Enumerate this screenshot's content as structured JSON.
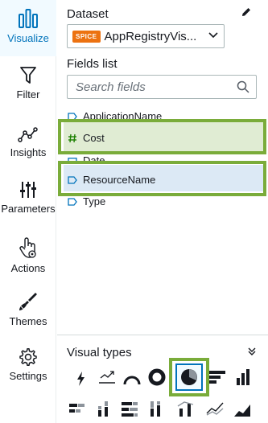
{
  "rail": {
    "items": [
      {
        "label": "Visualize",
        "icon": "visualize-icon",
        "active": true
      },
      {
        "label": "Filter",
        "icon": "filter-icon",
        "active": false
      },
      {
        "label": "Insights",
        "icon": "insights-icon",
        "active": false
      },
      {
        "label": "Parameters",
        "icon": "parameters-icon",
        "active": false
      },
      {
        "label": "Actions",
        "icon": "actions-icon",
        "active": false
      },
      {
        "label": "Themes",
        "icon": "themes-icon",
        "active": false
      },
      {
        "label": "Settings",
        "icon": "settings-icon",
        "active": false
      }
    ]
  },
  "dataset": {
    "title": "Dataset",
    "badge": "SPICE",
    "name": "AppRegistryVis...",
    "edit_icon": "pencil-icon"
  },
  "fields": {
    "title": "Fields list",
    "search_placeholder": "Search fields",
    "items": [
      {
        "label": "ApplicationName",
        "type": "dimension",
        "icon": "dimension-tag-icon"
      },
      {
        "label": "Cost",
        "type": "measure",
        "icon": "hash-icon",
        "highlighted": true
      },
      {
        "label": "Date",
        "type": "date",
        "icon": "calendar-icon"
      },
      {
        "label": "ResourceName",
        "type": "dimension",
        "icon": "dimension-tag-icon",
        "selected": true,
        "highlighted": true
      },
      {
        "label": "Type",
        "type": "dimension",
        "icon": "dimension-tag-icon"
      }
    ]
  },
  "visual_types": {
    "title": "Visual types",
    "selected": "pie-chart",
    "row1": [
      "autograph",
      "kpi",
      "gauge",
      "donut",
      "pie-chart",
      "horizontal-bar",
      "vertical-bar"
    ],
    "row2": [
      "horizontal-stacked-bar",
      "vertical-stacked-bar",
      "horizontal-100-bar",
      "vertical-100-bar",
      "combo-bar-line",
      "line-chart",
      "area-chart"
    ]
  },
  "colors": {
    "accent": "#0073bb",
    "highlight_border": "#7aac3a",
    "cost_fill": "#e0ecd3",
    "resource_fill": "#dce9f5",
    "spice_badge": "#ec7211"
  }
}
